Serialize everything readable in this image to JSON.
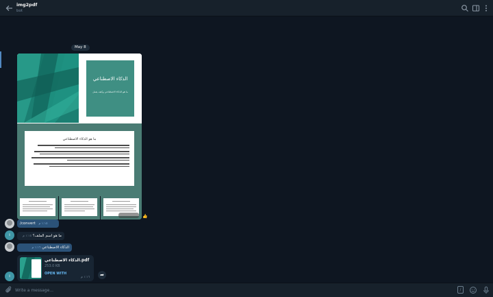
{
  "header": {
    "title": "img2pdf",
    "subtitle": "bot"
  },
  "date_separator": "May 8",
  "cover": {
    "title": "الذكاء الاصطناعي",
    "subtitle": "ما هو الذكاء الاصطناعي وكيف يعمل"
  },
  "page2": {
    "title": "ما هو الذكاء الاصطناعي"
  },
  "messages": [
    {
      "text": "/convert",
      "time": "١:١٥ م"
    },
    {
      "text": "ما هو اسم الملف؟",
      "time": "١:١٥ م"
    },
    {
      "text": "الذكاء الاصطناعي",
      "time": "١:١٦ م"
    }
  ],
  "file": {
    "name": "الذكاء الاصطناعي.pdf",
    "size": "253.0 KB",
    "action": "OPEN WITH",
    "time": "١:١٦ م"
  },
  "composer": {
    "placeholder": "Write a message..."
  },
  "colors": {
    "background": "#0e1621",
    "header": "#17212b",
    "outgoing_bubble": "#2b5278",
    "incoming_bubble": "#182533",
    "accent": "#64b5ef",
    "teal": "#1b7f72"
  },
  "icons": {
    "back": "arrow-left-icon",
    "search": "search-icon",
    "sidebar": "sidebar-toggle-icon",
    "more": "more-vertical-icon",
    "attach": "paperclip-icon",
    "commands": "slash-commands-icon",
    "emoji": "emoji-icon",
    "mic": "microphone-icon",
    "share": "share-arrow-icon"
  }
}
